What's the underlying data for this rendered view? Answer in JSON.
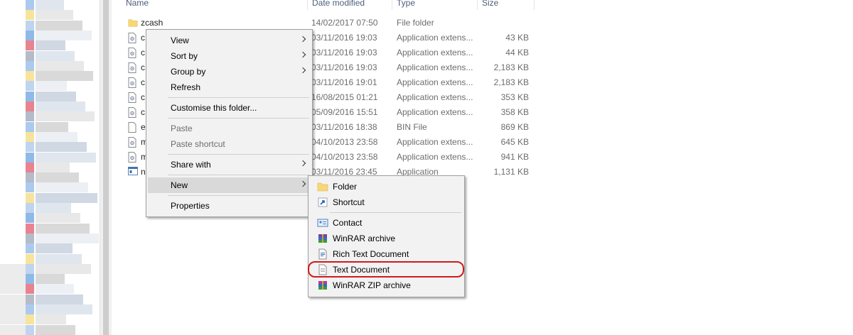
{
  "columns": {
    "name": "Name",
    "date": "Date modified",
    "type": "Type",
    "size": "Size"
  },
  "files": [
    {
      "name": "zcash",
      "date": "14/02/2017 07:50",
      "type": "File folder",
      "size": "",
      "icon": "folder-icon"
    },
    {
      "name": "c",
      "date": "03/11/2016 19:03",
      "type": "Application extens...",
      "size": "43 KB",
      "icon": "dll-icon"
    },
    {
      "name": "c",
      "date": "03/11/2016 19:03",
      "type": "Application extens...",
      "size": "44 KB",
      "icon": "dll-icon"
    },
    {
      "name": "c",
      "date": "03/11/2016 19:03",
      "type": "Application extens...",
      "size": "2,183 KB",
      "icon": "dll-icon"
    },
    {
      "name": "c",
      "date": "03/11/2016 19:01",
      "type": "Application extens...",
      "size": "2,183 KB",
      "icon": "dll-icon"
    },
    {
      "name": "c",
      "date": "16/08/2015 01:21",
      "type": "Application extens...",
      "size": "353 KB",
      "icon": "dll-icon"
    },
    {
      "name": "c",
      "date": "05/09/2016 15:51",
      "type": "Application extens...",
      "size": "358 KB",
      "icon": "dll-icon"
    },
    {
      "name": "e",
      "date": "03/11/2016 18:38",
      "type": "BIN File",
      "size": "869 KB",
      "icon": "blank-file-icon"
    },
    {
      "name": "m",
      "date": "04/10/2013 23:58",
      "type": "Application extens...",
      "size": "645 KB",
      "icon": "dll-icon"
    },
    {
      "name": "m",
      "date": "04/10/2013 23:58",
      "type": "Application extens...",
      "size": "941 KB",
      "icon": "dll-icon"
    },
    {
      "name": "n",
      "date": "03/11/2016 23:45",
      "type": "Application",
      "size": "1,131 KB",
      "icon": "exe-icon"
    }
  ],
  "context_menu": {
    "view": "View",
    "sort_by": "Sort by",
    "group_by": "Group by",
    "refresh": "Refresh",
    "customise": "Customise this folder...",
    "paste": "Paste",
    "paste_shortcut": "Paste shortcut",
    "share_with": "Share with",
    "new": "New",
    "properties": "Properties"
  },
  "new_submenu": {
    "folder": "Folder",
    "shortcut": "Shortcut",
    "contact": "Contact",
    "winrar_archive": "WinRAR archive",
    "rich_text": "Rich Text Document",
    "text_document": "Text Document",
    "winrar_zip": "WinRAR ZIP archive"
  },
  "colors": {
    "highlight": "#d11a1a",
    "menu_bg": "#f2f2f2",
    "hover": "#d9d9d9"
  }
}
